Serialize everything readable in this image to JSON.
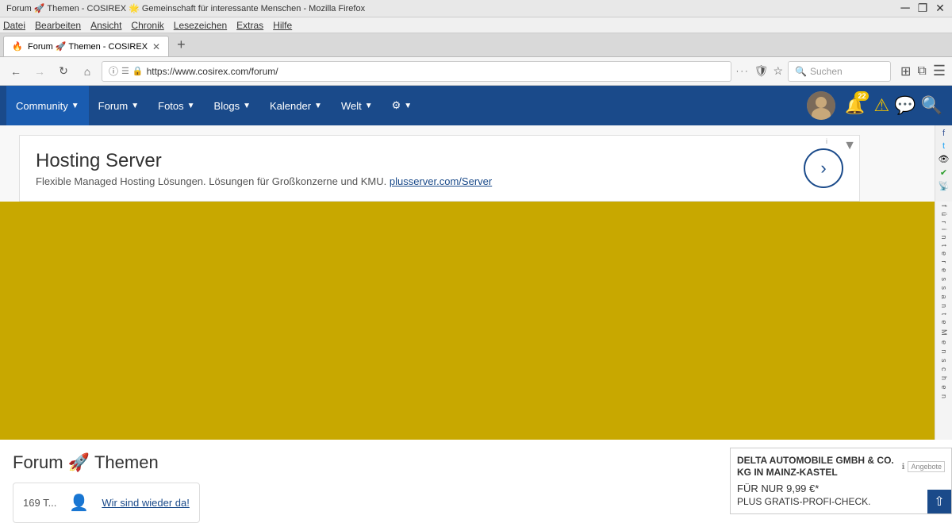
{
  "browser": {
    "titlebar": "Forum 🚀 Themen - COSIREX 🌟 Gemeinschaft für interessante Menschen - Mozilla Firefox",
    "menubar": {
      "items": [
        "Datei",
        "Bearbeiten",
        "Ansicht",
        "Chronik",
        "Lesezeichen",
        "Extras",
        "Hilfe"
      ]
    },
    "tab": {
      "label": "Forum 🚀 Themen - COSIREX",
      "favicon": "🔥"
    },
    "addressbar": {
      "url": "https://www.cosirex.com/forum/",
      "placeholder": "Suchen"
    },
    "controls": {
      "minimize": "─",
      "restore": "❐",
      "close": "✕"
    }
  },
  "navbar": {
    "items": [
      {
        "label": "Community",
        "has_dropdown": true
      },
      {
        "label": "Forum",
        "has_dropdown": true
      },
      {
        "label": "Fotos",
        "has_dropdown": true
      },
      {
        "label": "Blogs",
        "has_dropdown": true
      },
      {
        "label": "Kalender",
        "has_dropdown": true
      },
      {
        "label": "Welt",
        "has_dropdown": true
      },
      {
        "label": "🔧",
        "has_dropdown": true
      }
    ],
    "notification_count": "22",
    "avatar_emoji": "👤"
  },
  "ad_banner": {
    "title": "Hosting Server",
    "description": "Flexible Managed Hosting Lösungen. Lösungen für Großkonzerne und KMU.",
    "link_text": "plusserver.com/Server",
    "link_url": "#"
  },
  "right_sidebar": {
    "text": "f ü r i n t e r e s s a n t e M e n s c h e n",
    "icons": [
      "👁",
      "✔",
      "📡"
    ]
  },
  "page": {
    "title": "Forum",
    "rocket_emoji": "🚀",
    "subtitle": "Themen"
  },
  "bottom_ad": {
    "company": "DELTA AUTOMOBILE GMBH & CO. KG IN MAINZ-KASTEL",
    "offer_label": "Angebote",
    "price_text": "FÜR NUR 9,99 €*",
    "description": "PLUS GRATIS-PROFI-CHECK."
  },
  "forum_preview": {
    "count": "169 T...",
    "avatar_emoji": "👤",
    "link_text": "Wir sind wieder da!"
  }
}
